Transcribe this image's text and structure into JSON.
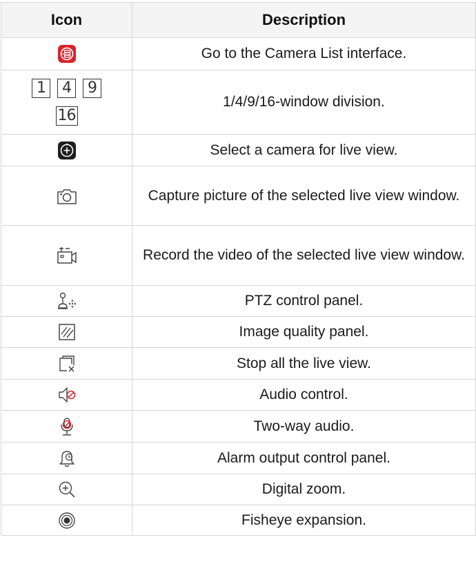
{
  "table": {
    "headers": {
      "icon": "Icon",
      "description": "Description"
    },
    "rows": [
      {
        "icon": "camera-list-icon",
        "description": "Go to the Camera List interface."
      },
      {
        "icon": "window-division-icons",
        "description": "1/4/9/16-window division.",
        "division_labels": [
          "1",
          "4",
          "9",
          "16"
        ]
      },
      {
        "icon": "add-camera-icon",
        "description": "Select a camera for live view."
      },
      {
        "icon": "capture-icon",
        "description": "Capture picture of the selected live view window."
      },
      {
        "icon": "record-icon",
        "description": "Record the video of the selected live view window."
      },
      {
        "icon": "ptz-joystick-icon",
        "description": "PTZ control panel."
      },
      {
        "icon": "image-quality-icon",
        "description": "Image quality panel."
      },
      {
        "icon": "stop-all-icon",
        "description": "Stop all the live view."
      },
      {
        "icon": "speaker-muted-icon",
        "description": "Audio control."
      },
      {
        "icon": "microphone-muted-icon",
        "description": "Two-way audio."
      },
      {
        "icon": "alarm-bell-icon",
        "description": "Alarm output control panel."
      },
      {
        "icon": "zoom-in-icon",
        "description": "Digital zoom."
      },
      {
        "icon": "fisheye-icon",
        "description": "Fisheye expansion."
      }
    ]
  },
  "colors": {
    "accent_red": "#d6242a",
    "icon_gray": "#444444",
    "header_bg": "#f4f4f4",
    "border": "#d6d6d6"
  }
}
